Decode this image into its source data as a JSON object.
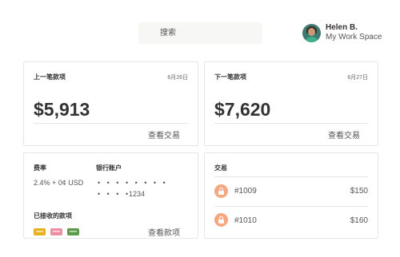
{
  "header": {
    "search_placeholder": "搜索",
    "user_name": "Helen B.",
    "workspace": "My Work Space"
  },
  "prev_payout": {
    "title": "上一笔款项",
    "date": "6月26日",
    "amount": "$5,913",
    "link": "查看交易"
  },
  "next_payout": {
    "title": "下一笔款项",
    "date": "6月27日",
    "amount": "$7,620",
    "link": "查看交易"
  },
  "fees": {
    "rate_label": "费率",
    "rate_value": "2.4% + 0¢ USD",
    "bank_label": "银行账户",
    "bank_dots_1": "• • • • • • • •",
    "bank_dots_2": "• • • •",
    "bank_last4": "1234",
    "received_label": "已接收的款项",
    "link": "查看款项",
    "swatch_colors": [
      "#e8b21c",
      "#ee8ea5",
      "#5d9a4a"
    ]
  },
  "transactions": {
    "title": "交易",
    "items": [
      {
        "id": "#1009",
        "amount": "$150"
      },
      {
        "id": "#1010",
        "amount": "$160"
      }
    ],
    "icon_color": "#f5a77f"
  }
}
